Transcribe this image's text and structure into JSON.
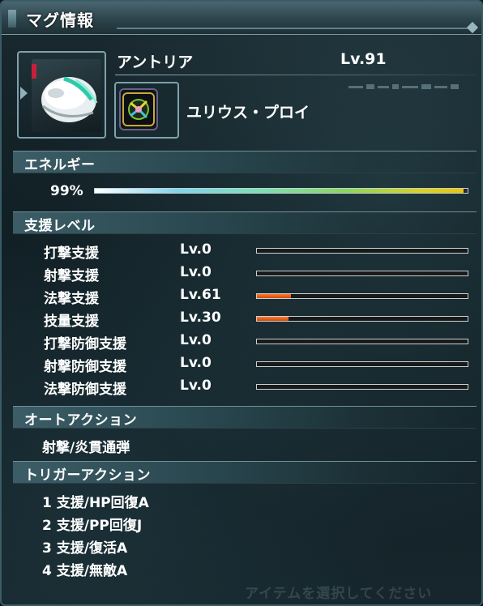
{
  "window": {
    "title": "マグ情報"
  },
  "mag": {
    "name": "アントリア",
    "level": "Lv.91",
    "photon_blast": "ユリウス・プロイ"
  },
  "energy": {
    "header": "エネルギー",
    "percent_label": "99%",
    "value": 0.99
  },
  "support": {
    "header": "支援レベル",
    "rows": [
      {
        "name": "打撃支援",
        "level": "Lv.0",
        "fill": 0.0
      },
      {
        "name": "射撃支援",
        "level": "Lv.0",
        "fill": 0.0
      },
      {
        "name": "法撃支援",
        "level": "Lv.61",
        "fill": 0.16
      },
      {
        "name": "技量支援",
        "level": "Lv.30",
        "fill": 0.15
      },
      {
        "name": "打撃防御支援",
        "level": "Lv.0",
        "fill": 0.0
      },
      {
        "name": "射撃防御支援",
        "level": "Lv.0",
        "fill": 0.0
      },
      {
        "name": "法撃防御支援",
        "level": "Lv.0",
        "fill": 0.0
      }
    ]
  },
  "auto_action": {
    "header": "オートアクション",
    "value": "射撃/炎貫通弾"
  },
  "trigger_action": {
    "header": "トリガーアクション",
    "items": [
      "1 支援/HP回復A",
      "2 支援/PP回復J",
      "3 支援/復活A",
      "4 支援/無敵A"
    ]
  },
  "footer_hint": "アイテムを選択してください",
  "colors": {
    "panel_bg": "#0f1c21",
    "header_accent": "#3c5d67",
    "support_fill": "#e0560e",
    "energy_gradient_end": "#f0c400"
  },
  "icons": {
    "mag_item": "mag-helmet-icon",
    "photon_blast": "photon-blast-icon"
  }
}
